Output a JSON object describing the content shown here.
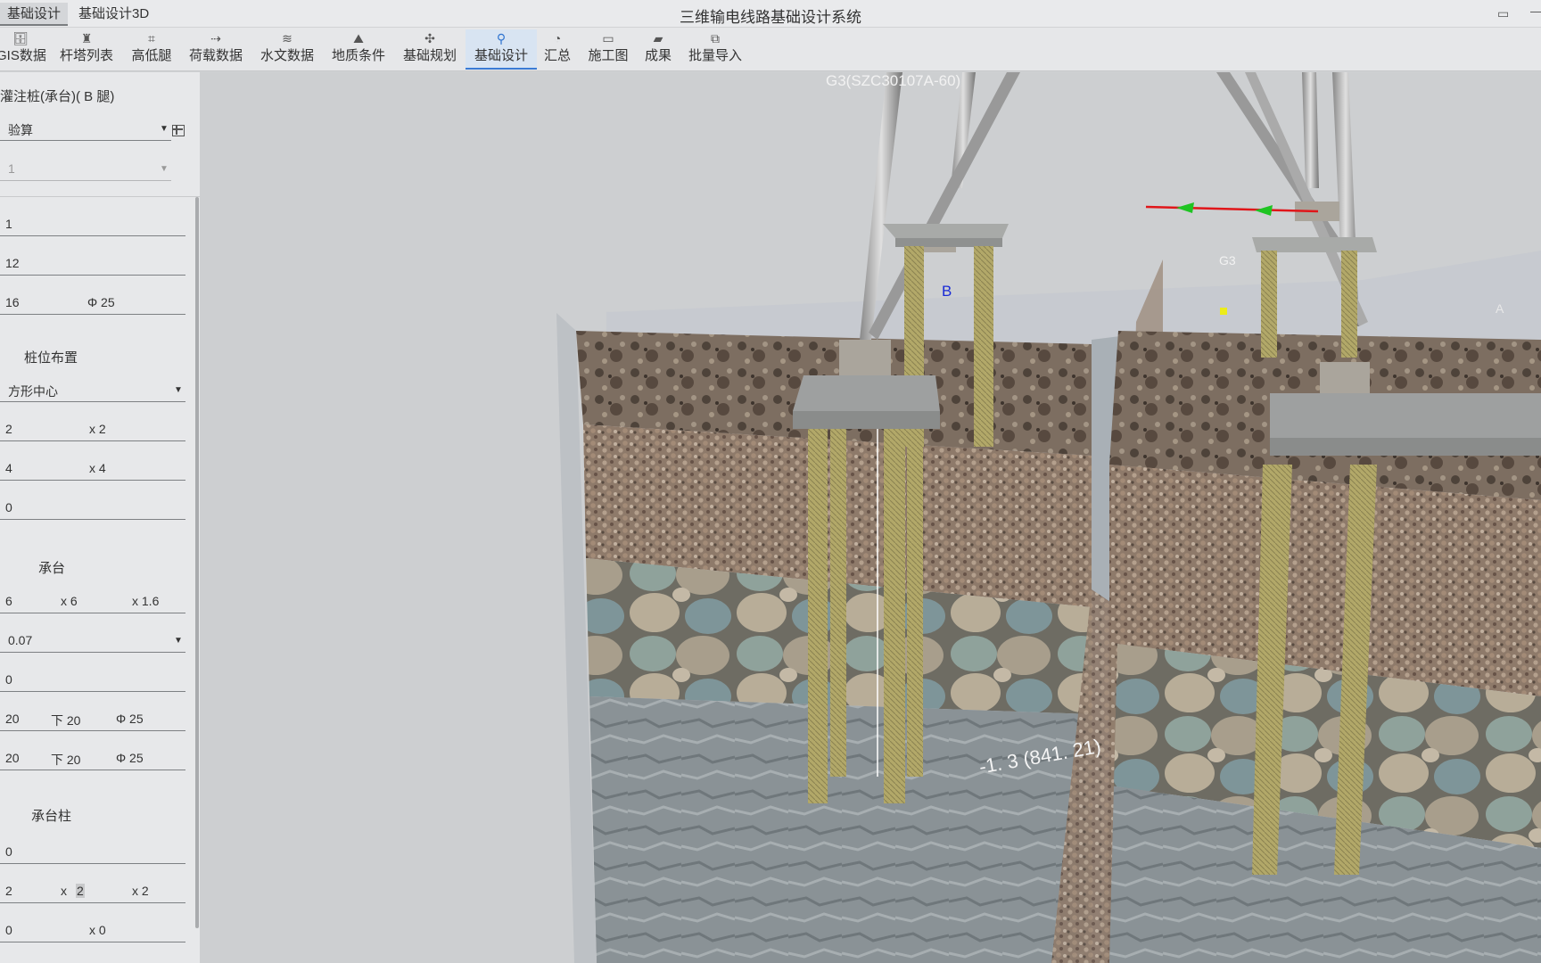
{
  "window": {
    "title": "三维输电线路基础设计系统",
    "tabs": [
      "基础设计",
      "基础设计3D"
    ]
  },
  "toolbar": {
    "items": [
      {
        "label": "GIS数据",
        "icon": "database-icon"
      },
      {
        "label": "杆塔列表",
        "icon": "tower-icon"
      },
      {
        "label": "高低腿",
        "icon": "legs-icon"
      },
      {
        "label": "荷载数据",
        "icon": "load-icon"
      },
      {
        "label": "水文数据",
        "icon": "hydrology-icon"
      },
      {
        "label": "地质条件",
        "icon": "geology-icon"
      },
      {
        "label": "基础规划",
        "icon": "planning-icon"
      },
      {
        "label": "基础设计",
        "icon": "foundation-design-icon"
      },
      {
        "label": "汇总",
        "icon": "summary-pie-icon"
      },
      {
        "label": "施工图",
        "icon": "drawing-icon"
      },
      {
        "label": "成果",
        "icon": "folder-icon"
      },
      {
        "label": "批量导入",
        "icon": "import-icon"
      }
    ],
    "active": "基础设计"
  },
  "panel": {
    "title": "灌注桩(承台)( B 腿)",
    "mode_select": "验算",
    "disabled_select": "1",
    "rows": {
      "r1": "1",
      "r2": "12",
      "r3a": "16",
      "r3b": "Φ 25",
      "pile_layout_heading": "桩位布置",
      "layout_select": "方形中心",
      "r4a": "2",
      "r4b": "x 2",
      "r5a": "4",
      "r5b": "x 4",
      "r6": "0",
      "cap_heading": "承台",
      "r7a": "6",
      "r7b": "x 6",
      "r7c": "x 1.6",
      "r8_select": "0.07",
      "r9": "0",
      "r10a": "20",
      "r10b": "下 20",
      "r10c": "Φ 25",
      "r11a": "20",
      "r11b": "下 20",
      "r11c": "Φ 25",
      "cap_column_heading": "承台柱",
      "r12": "0",
      "r13a": "2",
      "r13b": "x",
      "r13b_val": "2",
      "r13c": "x 2",
      "r14a": "0",
      "r14b": "x 0"
    }
  },
  "viewport": {
    "tower_label": "G3(SZC30107A-60)",
    "marker_label": "G3",
    "leg_b_label": "B",
    "leg_a_label": "A",
    "elevation_label": "-1. 3 (841. 21)",
    "colors": {
      "background": "#cdcfd1",
      "soil_top": "#7d6e61",
      "gravel": "#8e7a6a",
      "cobbles": "#8f9a95",
      "rock": "#8a9296",
      "pile": "#b2a869",
      "cap": "#9ea0a0",
      "arrow_red": "#e0161a",
      "arrow_green": "#1ec422",
      "marker_yellow": "#ecec19",
      "leg_b_blue": "#1a2bd6"
    }
  }
}
